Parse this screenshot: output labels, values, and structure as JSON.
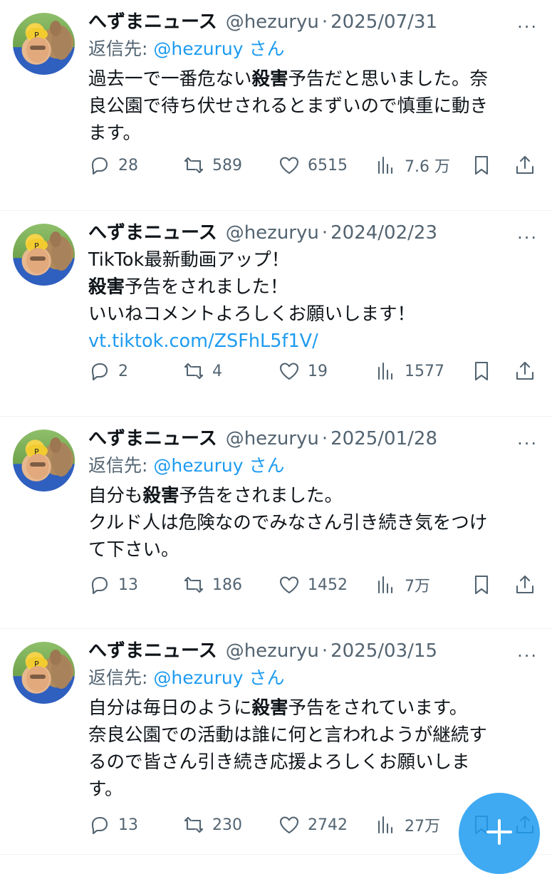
{
  "tweets": [
    {
      "name": "へずまニュース",
      "handle": "@hezuryu",
      "dot": "·",
      "date": "2025/07/31",
      "reply_prefix": "返信先: ",
      "reply_to": "@hezuruy",
      "reply_suffix": " さん",
      "lines": [
        {
          "pre": "過去一で一番危ない",
          "bold": "殺害",
          "post": "予告だと思いました。奈"
        },
        {
          "pre": "良公園で待ち伏せされるとまずいので慎重に動き",
          "bold": "",
          "post": ""
        },
        {
          "pre": "ます。",
          "bold": "",
          "post": ""
        }
      ],
      "replies": "28",
      "reposts": "589",
      "likes": "6515",
      "views": "7.6 万"
    },
    {
      "name": "へずまニュース",
      "handle": "@hezuryu",
      "dot": "·",
      "date": "2024/02/23",
      "lines": [
        {
          "pre": "TikTok最新動画アップ！",
          "bold": "",
          "post": ""
        },
        {
          "pre": "",
          "bold": "殺害",
          "post": "予告をされました！"
        },
        {
          "pre": "いいねコメントよろしくお願いします！",
          "bold": "",
          "post": ""
        }
      ],
      "link": "vt.tiktok.com/ZSFhL5f1V/",
      "replies": "2",
      "reposts": "4",
      "likes": "19",
      "views": "1577"
    },
    {
      "name": "へずまニュース",
      "handle": "@hezuryu",
      "dot": "·",
      "date": "2025/01/28",
      "reply_prefix": "返信先: ",
      "reply_to": "@hezuruy",
      "reply_suffix": " さん",
      "lines": [
        {
          "pre": "自分も",
          "bold": "殺害",
          "post": "予告をされました。"
        },
        {
          "pre": "クルド人は危険なのでみなさん引き続き気をつけ",
          "bold": "",
          "post": ""
        },
        {
          "pre": "て下さい。",
          "bold": "",
          "post": ""
        }
      ],
      "replies": "13",
      "reposts": "186",
      "likes": "1452",
      "views": "7万"
    },
    {
      "name": "へずまニュース",
      "handle": "@hezuryu",
      "dot": "·",
      "date": "2025/03/15",
      "reply_prefix": "返信先: ",
      "reply_to": "@hezuruy",
      "reply_suffix": " さん",
      "lines": [
        {
          "pre": "自分は毎日のように",
          "bold": "殺害",
          "post": "予告をされています。"
        },
        {
          "pre": "奈良公園での活動は誰に何と言われようが継続す",
          "bold": "",
          "post": ""
        },
        {
          "pre": "るので皆さん引き続き応援よろしくお願いしま",
          "bold": "",
          "post": ""
        },
        {
          "pre": "す。",
          "bold": "",
          "post": ""
        }
      ],
      "replies": "13",
      "reposts": "230",
      "likes": "2742",
      "views": "27万"
    }
  ],
  "icons": {
    "reply": "reply-icon",
    "repost": "repost-icon",
    "like": "heart-icon",
    "views": "views-icon",
    "bookmark": "bookmark-icon",
    "share": "share-icon",
    "more": "more-icon",
    "compose": "compose-plus-icon"
  },
  "more_glyph": "···",
  "colors": {
    "accent": "#1d9bf0",
    "muted": "#536471",
    "text": "#0f1419"
  }
}
